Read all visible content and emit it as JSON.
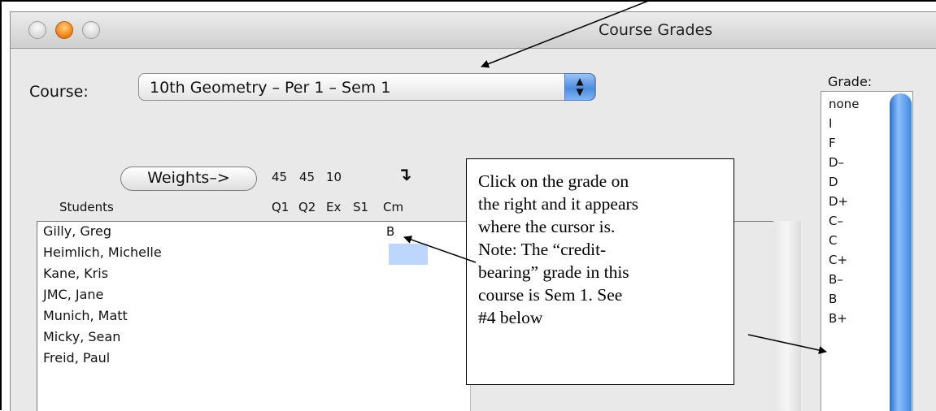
{
  "window": {
    "title": "Course Grades"
  },
  "course": {
    "label": "Course:",
    "value": "10th Geometry – Per 1 – Sem 1",
    "stepper_glyph": "▲\n▼"
  },
  "weights": {
    "button_label": "Weights–>",
    "values": [
      "45",
      "45",
      "10"
    ],
    "arrow_glyph": "↴"
  },
  "columns": [
    "Students",
    "Q1",
    "Q2",
    "Ex",
    "S1",
    "Cm"
  ],
  "students": [
    "Gilly, Greg",
    "Heimlich, Michelle",
    "Kane, Kris",
    "JMC, Jane",
    "Munich, Matt",
    "Micky, Sean",
    "Freid, Paul"
  ],
  "grade_cell": "B",
  "grade_panel": {
    "label": "Grade:",
    "options": [
      "none",
      "I",
      "F",
      "D–",
      "D",
      "D+",
      "C–",
      "C",
      "C+",
      "B–",
      "B",
      "B+"
    ]
  },
  "callout": {
    "lines": [
      "Click on the grade on",
      "the right and it appears",
      "where the cursor is.",
      "Note: The “credit-",
      "bearing” grade in this",
      "course is Sem 1. See",
      "#4 below"
    ]
  },
  "colors": {
    "accent": "#4b8ce0",
    "selection": "#bcd7fb",
    "minimize": "#ef7a12"
  }
}
